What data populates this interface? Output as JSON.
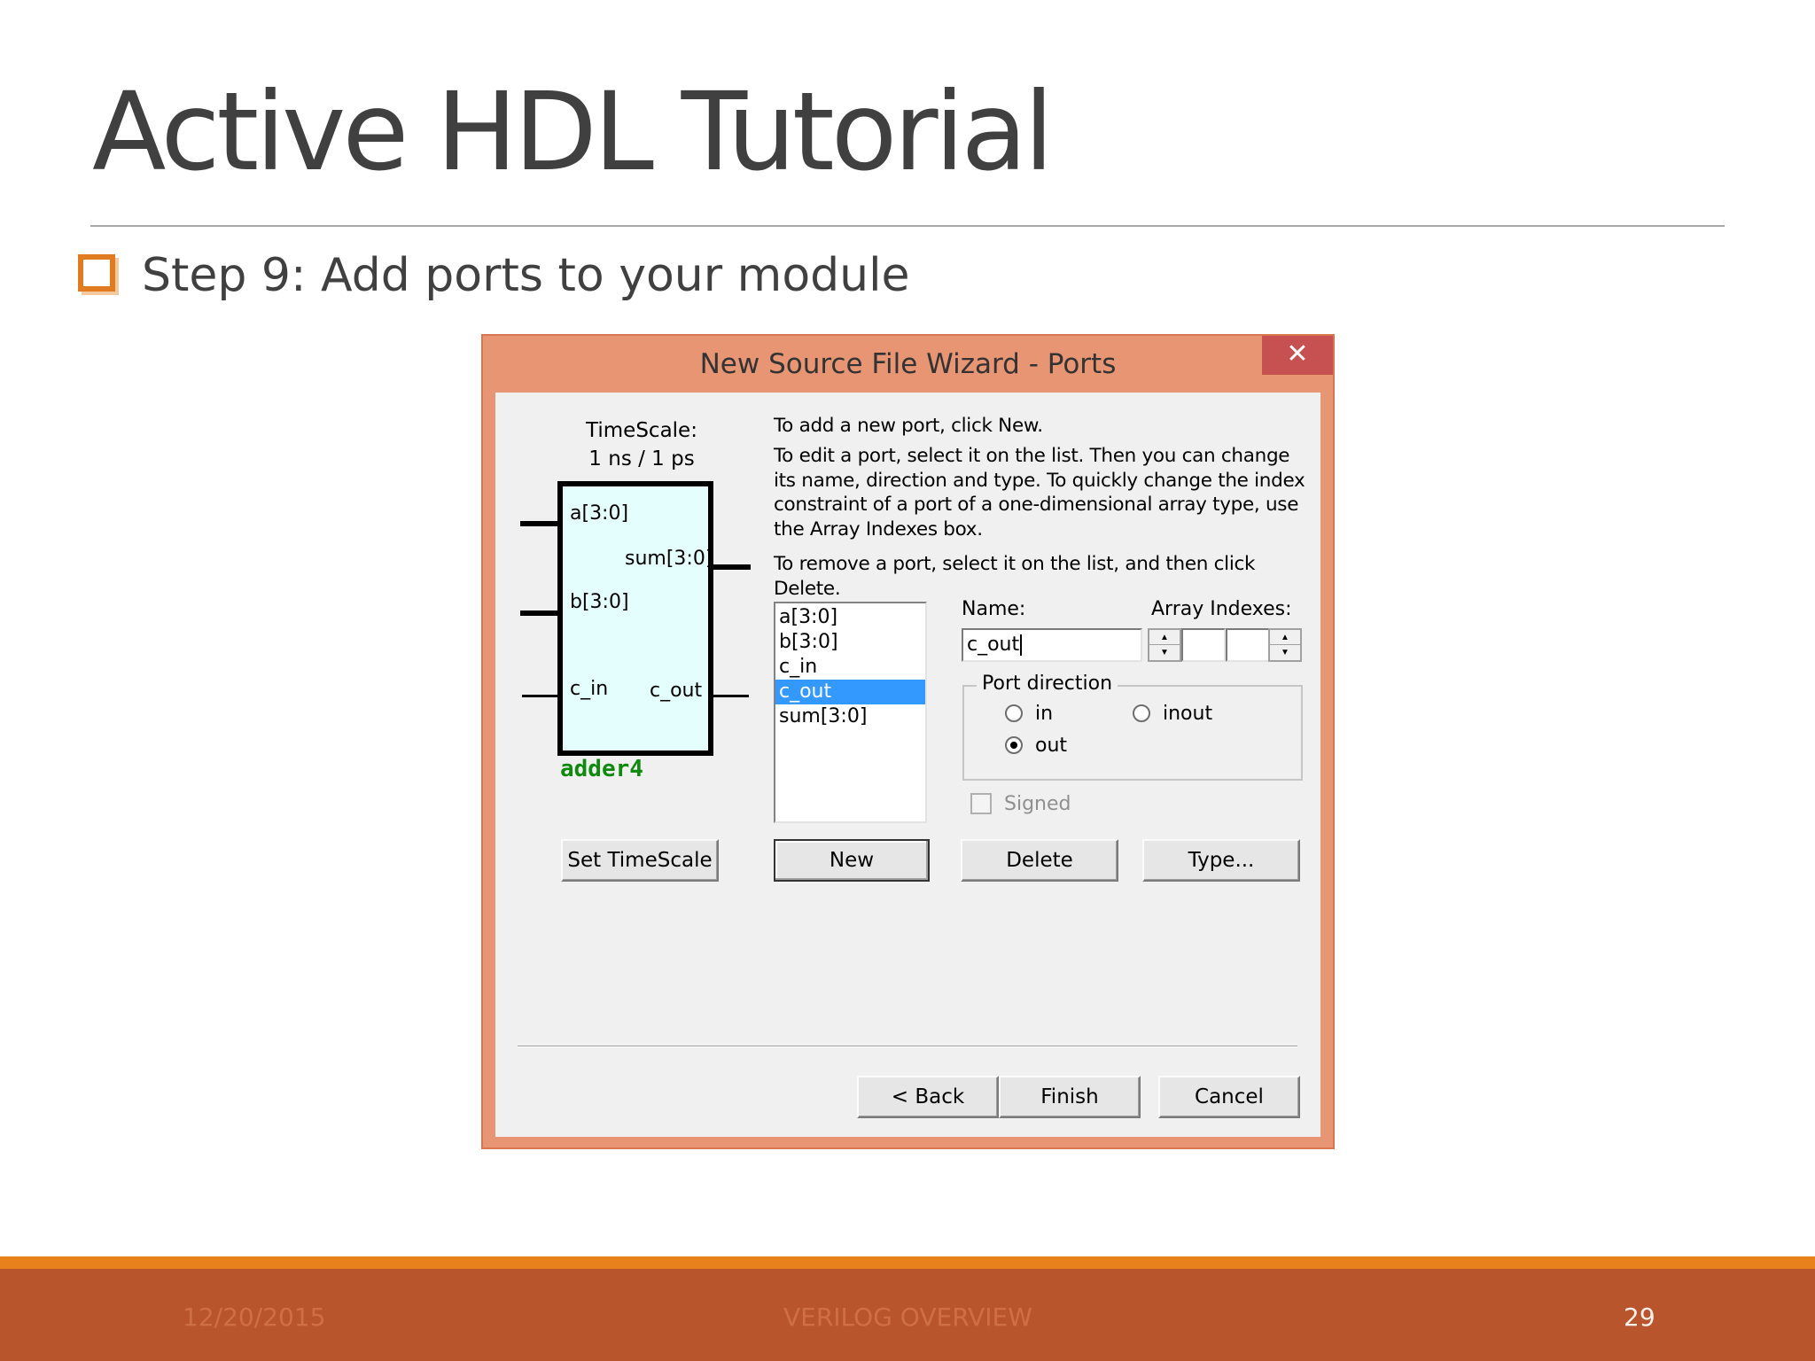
{
  "slide": {
    "title": "Active HDL Tutorial",
    "step": "Step 9: Add ports to your module",
    "footer_date": "12/20/2015",
    "footer_center": "VERILOG OVERVIEW",
    "page_number": "29"
  },
  "dialog": {
    "title": "New Source File Wizard - Ports",
    "close": "✕",
    "timescale_label": "TimeScale:",
    "timescale_value": "1 ns / 1 ps",
    "symbol": {
      "pins": {
        "a": "a[3:0]",
        "sum": "sum[3:0]",
        "b": "b[3:0]",
        "c_in": "c_in",
        "c_out": "c_out"
      },
      "module_name": "adder4"
    },
    "instructions": {
      "p1": "To add a new port, click New.",
      "p2": "To edit a port, select it on the list. Then you can change\nits name, direction and type. To quickly change the index\nconstraint of a port of a one-dimensional array type, use\nthe Array Indexes box.",
      "p3": "To remove a port, select it on the list, and then click\nDelete."
    },
    "ports": [
      "a[3:0]",
      "b[3:0]",
      "c_in",
      "c_out",
      "sum[3:0]"
    ],
    "selected_port": "c_out",
    "name_label": "Name:",
    "name_value": "c_out",
    "array_indexes_label": "Array Indexes:",
    "port_direction": {
      "legend": "Port direction",
      "options": {
        "in": "in",
        "inout": "inout",
        "out": "out"
      },
      "selected": "out"
    },
    "signed_label": "Signed",
    "buttons": {
      "set_timescale": "Set TimeScale",
      "new": "New",
      "delete": "Delete",
      "type": "Type...",
      "back": "< Back",
      "finish": "Finish",
      "cancel": "Cancel"
    }
  },
  "colors": {
    "accent": "#e8801c",
    "footer": "#b9552c",
    "dialog_frame": "#e89574",
    "selection": "#3399ff",
    "module_name": "#0f8a0f"
  }
}
